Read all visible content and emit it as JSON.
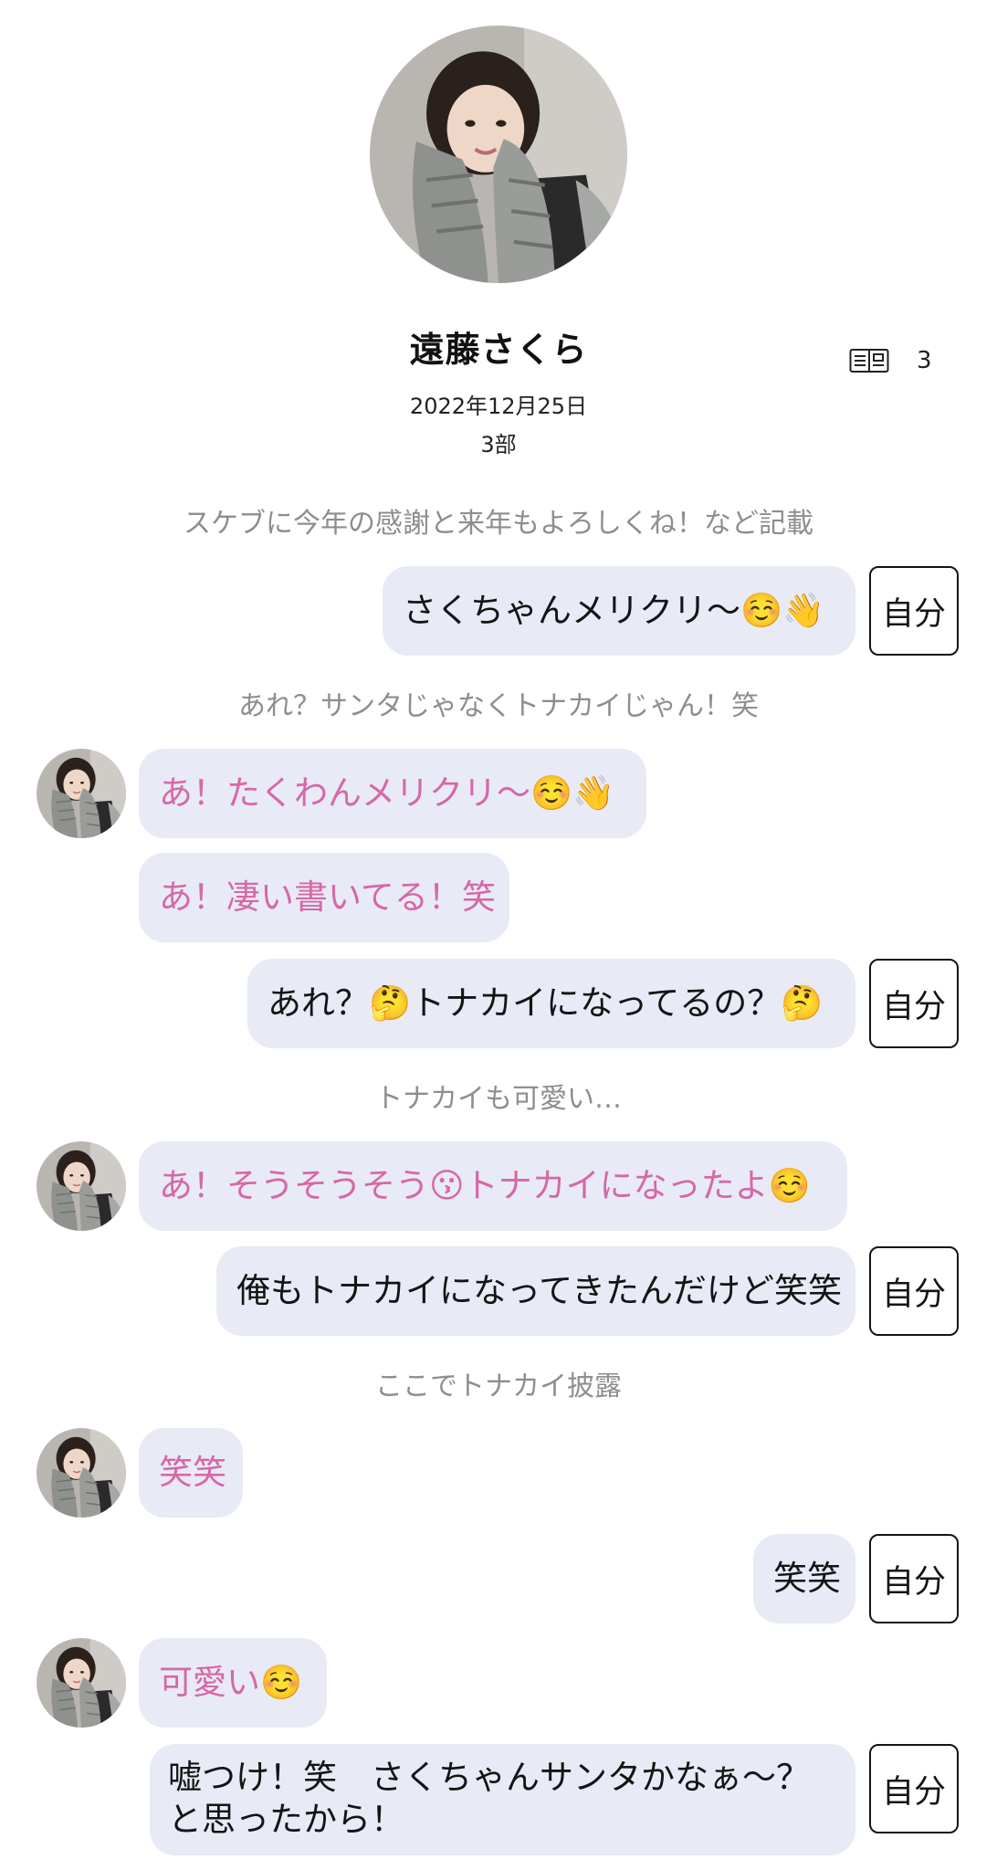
{
  "profile": {
    "name": "遠藤さくら",
    "date": "2022年12月25日",
    "part": "3部",
    "count": "3"
  },
  "icons": {
    "count": "book-icon",
    "avatar": "idol-avatar"
  },
  "colors": {
    "bubble_bg": "#e8eaf5",
    "idol_text": "#d568a8",
    "self_text": "#141414",
    "note_text": "#8e8e8e"
  },
  "self_label": "自分",
  "chat": {
    "note_1": "スケブに今年の感謝と来年もよろしくね！など記載",
    "msg_1": "さくちゃんメリクリ〜☺️👋",
    "note_2": "あれ？サンタじゃなくトナカイじゃん！笑",
    "msg_2": "あ！たくわんメリクリ〜☺️👋",
    "msg_3": "あ！凄い書いてる！笑",
    "msg_4": "あれ？🤔トナカイになってるの？🤔",
    "note_3": "トナカイも可愛い…",
    "msg_5": "あ！そうそうそう😗トナカイになったよ☺️",
    "msg_6": "俺もトナカイになってきたんだけど笑笑",
    "note_4": "ここでトナカイ披露",
    "msg_7": "笑笑",
    "msg_8": "笑笑",
    "msg_9": "可愛い☺️",
    "msg_10": "嘘つけ！笑　さくちゃんサンタかなぁ〜？と思ったから！"
  }
}
